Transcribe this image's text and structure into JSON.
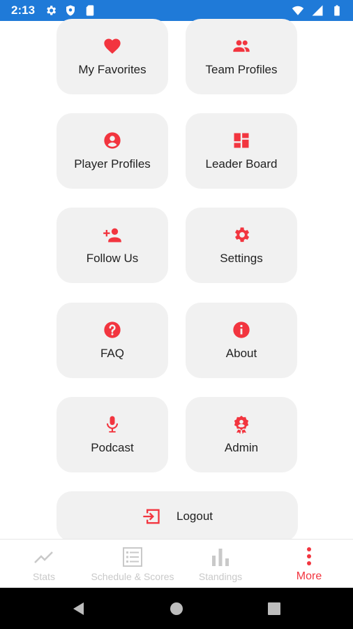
{
  "status_bar": {
    "time": "2:13"
  },
  "menu": {
    "tiles": [
      {
        "label": "My Favorites",
        "icon": "heart-icon"
      },
      {
        "label": "Team Profiles",
        "icon": "group-icon"
      },
      {
        "label": "Player Profiles",
        "icon": "account-circle-icon"
      },
      {
        "label": "Leader Board",
        "icon": "dashboard-icon"
      },
      {
        "label": "Follow Us",
        "icon": "person-add-icon"
      },
      {
        "label": "Settings",
        "icon": "gear-icon"
      },
      {
        "label": "FAQ",
        "icon": "help-icon"
      },
      {
        "label": "About",
        "icon": "info-icon"
      },
      {
        "label": "Podcast",
        "icon": "microphone-icon"
      },
      {
        "label": "Admin",
        "icon": "admin-badge-icon"
      }
    ],
    "logout": {
      "label": "Logout",
      "icon": "logout-icon"
    }
  },
  "bottom_nav": {
    "items": [
      {
        "label": "Stats",
        "icon": "trending-icon"
      },
      {
        "label": "Schedule & Scores",
        "icon": "list-icon"
      },
      {
        "label": "Standings",
        "icon": "bar-chart-icon"
      },
      {
        "label": "More",
        "icon": "more-vert-icon"
      }
    ],
    "active": "More"
  },
  "colors": {
    "accent": "#f2353f",
    "tile_bg": "#f1f1f1",
    "status_bar": "#1f7ad8"
  }
}
